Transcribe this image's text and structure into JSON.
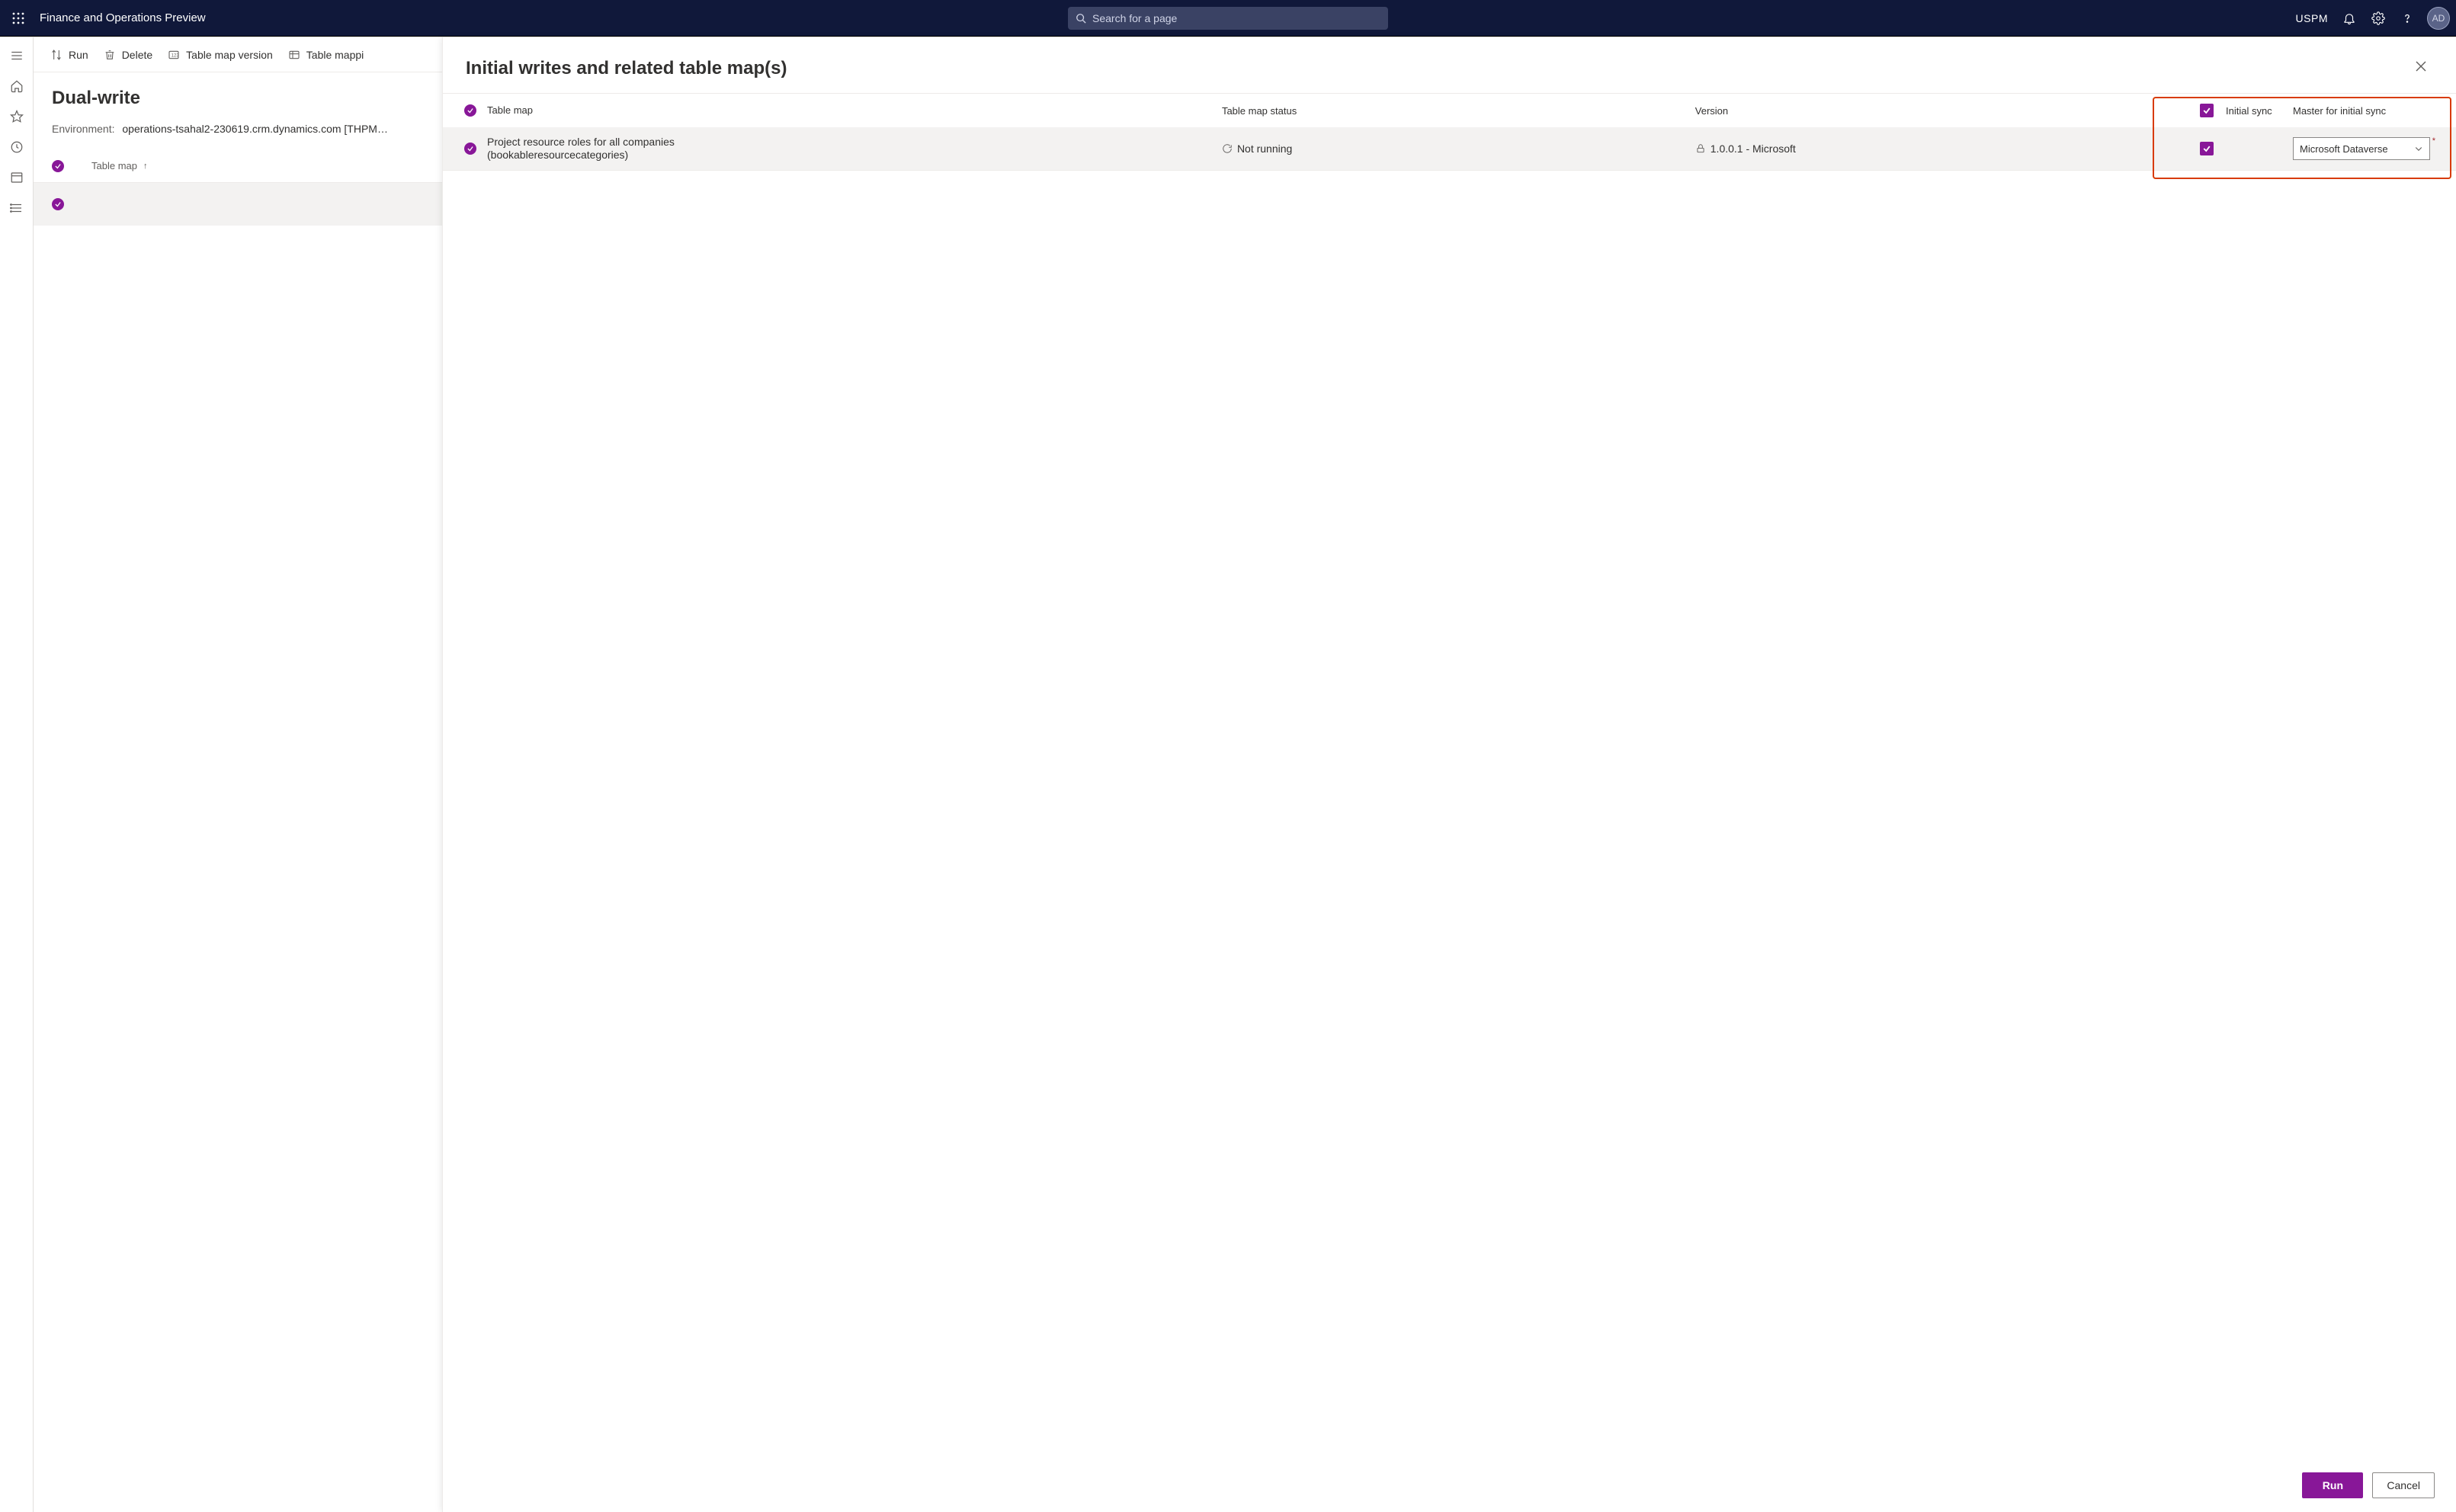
{
  "topbar": {
    "title": "Finance and Operations Preview",
    "search_placeholder": "Search for a page",
    "company": "USPM",
    "avatar": "AD"
  },
  "commands": {
    "run": "Run",
    "delete": "Delete",
    "version": "Table map version",
    "mappings": "Table mappi"
  },
  "page": {
    "title": "Dual-write",
    "env_label": "Environment:",
    "env_value": "operations-tsahal2-230619.crm.dynamics.com [THPM…"
  },
  "list": {
    "header": {
      "tablemap": "Table map"
    },
    "row": {
      "line1": "Project resource roles for all companies",
      "line2": "(bookableresourcecategories)"
    }
  },
  "panel": {
    "title": "Initial writes and related table map(s)",
    "headers": {
      "map": "Table map",
      "status": "Table map status",
      "version": "Version",
      "initsync": "Initial sync",
      "master": "Master for initial sync"
    },
    "row": {
      "map1": "Project resource roles for all companies",
      "map2": "(bookableresourcecategories)",
      "status": "Not running",
      "version": "1.0.0.1 - Microsoft",
      "master": "Microsoft Dataverse"
    },
    "buttons": {
      "run": "Run",
      "cancel": "Cancel"
    }
  }
}
